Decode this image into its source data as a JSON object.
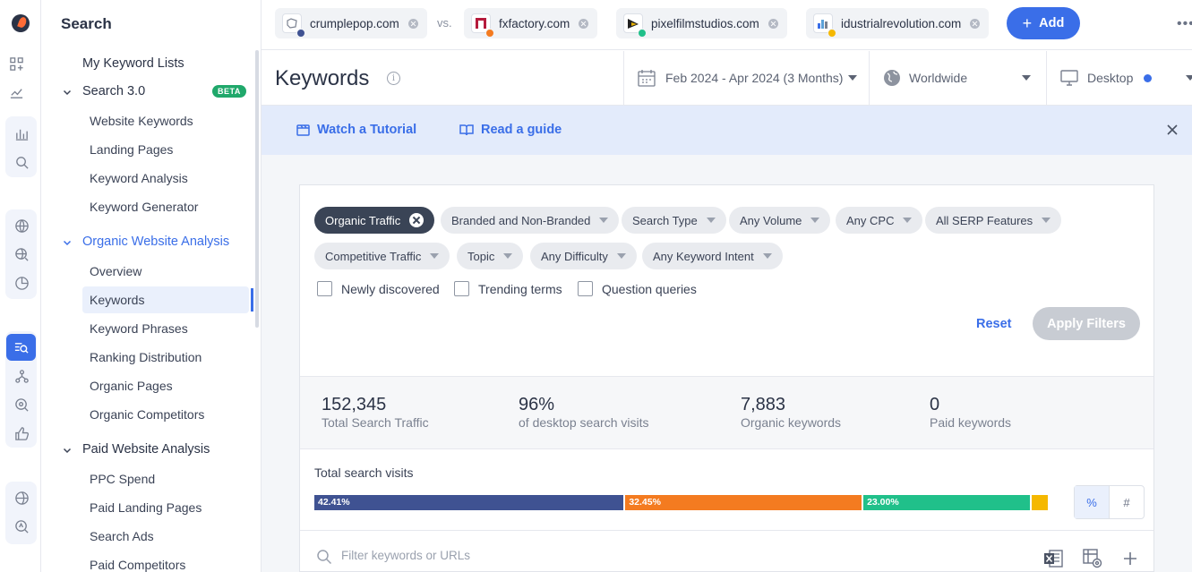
{
  "sidebar": {
    "title": "Search",
    "my_lists": "My Keyword Lists",
    "search30": {
      "label": "Search 3.0",
      "badge": "BETA"
    },
    "search30_items": [
      "Website Keywords",
      "Landing Pages",
      "Keyword Analysis",
      "Keyword Generator"
    ],
    "organic": {
      "label": "Organic Website Analysis"
    },
    "organic_items": [
      "Overview",
      "Keywords",
      "Keyword Phrases",
      "Ranking Distribution",
      "Organic Pages",
      "Organic Competitors"
    ],
    "paid": {
      "label": "Paid Website Analysis"
    },
    "paid_items": [
      "PPC Spend",
      "Paid Landing Pages",
      "Search Ads",
      "Paid Competitors"
    ]
  },
  "topbar": {
    "sites": [
      {
        "name": "crumplepop.com",
        "dot": "#3f5292"
      },
      {
        "name": "fxfactory.com",
        "dot": "#f47b20"
      },
      {
        "name": "pixelfilmstudios.com",
        "dot": "#20c08a"
      },
      {
        "name": "idustrialrevolution.com",
        "dot": "#f5b800"
      }
    ],
    "vs": "vs.",
    "add_label": "Add",
    "more": "•••"
  },
  "header": {
    "title": "Keywords",
    "info": "i",
    "date_range": "Feb 2024 - Apr 2024 (3 Months)",
    "country": "Worldwide",
    "device": "Desktop"
  },
  "banner": {
    "tutorial": "Watch a Tutorial",
    "guide": "Read a guide"
  },
  "filters": {
    "chips_row1": [
      "Organic Traffic",
      "Branded and Non-Branded",
      "Search Type",
      "Any Volume",
      "Any CPC",
      "All SERP Features"
    ],
    "chips_row2": [
      "Competitive Traffic",
      "Topic",
      "Any Difficulty",
      "Any Keyword Intent"
    ],
    "checkboxes": [
      "Newly discovered",
      "Trending terms",
      "Question queries"
    ],
    "reset": "Reset",
    "apply": "Apply Filters"
  },
  "stats": [
    {
      "value": "152,345",
      "label": "Total Search Traffic"
    },
    {
      "value": "96%",
      "label": "of desktop search visits"
    },
    {
      "value": "7,883",
      "label": "Organic keywords"
    },
    {
      "value": "0",
      "label": "Paid keywords"
    }
  ],
  "visits": {
    "title": "Total search visits",
    "segments": [
      {
        "label": "42.41%",
        "value": 42.41,
        "color": "#3f5292"
      },
      {
        "label": "32.45%",
        "value": 32.45,
        "color": "#f47b20"
      },
      {
        "label": "23.00%",
        "value": 23.0,
        "color": "#20c08a"
      },
      {
        "label": "",
        "value": 2.14,
        "color": "#f5b800"
      }
    ],
    "toggle_percent": "%",
    "toggle_number": "#"
  },
  "table": {
    "filter_placeholder": "Filter keywords or URLs"
  },
  "colors": {
    "accent": "#3a6ee8",
    "beta": "#20a86b"
  }
}
